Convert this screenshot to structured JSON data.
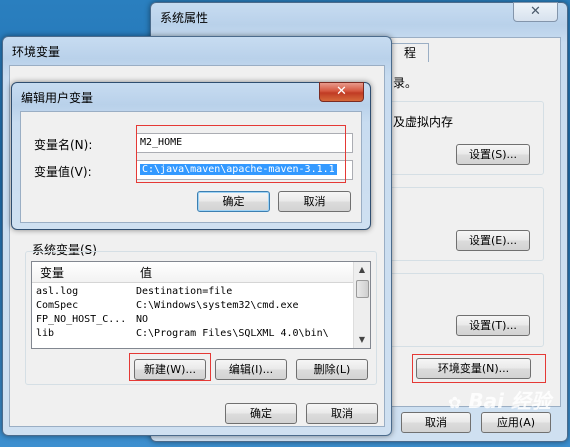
{
  "system_props": {
    "title": "系统属性",
    "tab_label": "程",
    "desc_text": "录。",
    "virtual_memory_text": "及虚拟内存",
    "settings_buttons": [
      "设置(S)...",
      "设置(E)...",
      "设置(T)..."
    ],
    "env_var_button": "环境变量(N)...",
    "cancel": "取消",
    "apply": "应用(A)"
  },
  "env_vars": {
    "title": "环境变量",
    "system_vars_label": "系统变量(S)",
    "col_variable": "变量",
    "col_value": "值",
    "rows": [
      {
        "name": "asl.log",
        "value": "Destination=file"
      },
      {
        "name": "ComSpec",
        "value": "C:\\Windows\\system32\\cmd.exe"
      },
      {
        "name": "FP_NO_HOST_C...",
        "value": "NO"
      },
      {
        "name": "lib",
        "value": "C:\\Program Files\\SQLXML 4.0\\bin\\"
      }
    ],
    "new_button": "新建(W)...",
    "edit_button": "编辑(I)...",
    "delete_button": "删除(L)",
    "ok": "确定",
    "cancel": "取消"
  },
  "edit_dialog": {
    "title": "编辑用户变量",
    "name_label": "变量名(N):",
    "value_label": "变量值(V):",
    "name_value": "M2_HOME",
    "value_value": "C:\\java\\maven\\apache-maven-3.1.1",
    "ok": "确定",
    "cancel": "取消"
  },
  "watermark": "Bai 经验",
  "colors": {
    "highlight": "#e53935",
    "selection": "#3399ff"
  }
}
